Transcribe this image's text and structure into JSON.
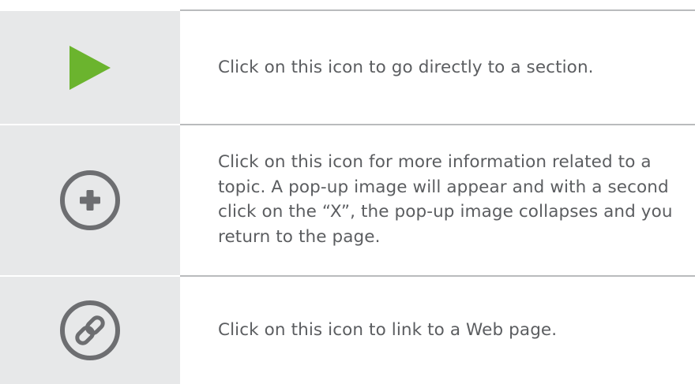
{
  "items": [
    {
      "icon": "play-triangle-icon",
      "icon_color": "#6bb42e",
      "text": "Click on this icon to go directly to a section."
    },
    {
      "icon": "circle-plus-icon",
      "icon_color": "#6d6e71",
      "text": "Click on this icon for more information related to a topic. A pop-up image will appear and with a second click on the “X”, the pop-up image collapses and you return to the page."
    },
    {
      "icon": "circle-link-icon",
      "icon_color": "#6d6e71",
      "text": "Click on this icon to link to a Web page."
    }
  ]
}
